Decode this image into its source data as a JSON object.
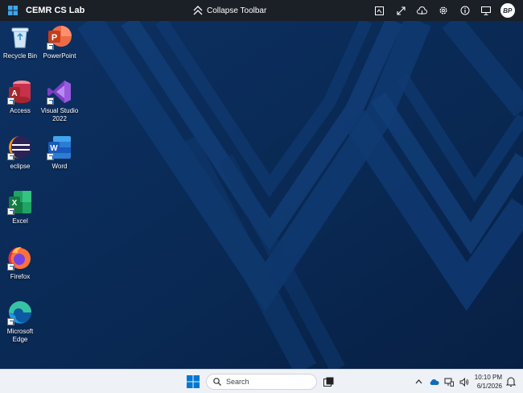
{
  "toolbar": {
    "title": "CEMR CS Lab",
    "collapse_label": "Collapse Toolbar",
    "avatar_initials": "BP",
    "icons": [
      "fit-screen-icon",
      "fullscreen-icon",
      "cloud-sync-icon",
      "settings-icon",
      "info-icon",
      "display-icon",
      "user-avatar"
    ]
  },
  "desktop": {
    "icons": [
      {
        "label": "Recycle Bin",
        "icon": "recycle-bin-icon"
      },
      {
        "label": "PowerPoint",
        "icon": "powerpoint-icon"
      },
      {
        "label": "Access",
        "icon": "access-icon"
      },
      {
        "label": "Visual Studio 2022",
        "icon": "visual-studio-icon"
      },
      {
        "label": "eclipse",
        "icon": "eclipse-icon"
      },
      {
        "label": "Word",
        "icon": "word-icon"
      },
      {
        "label": "Excel",
        "icon": "excel-icon"
      },
      {
        "label": "Firefox",
        "icon": "firefox-icon"
      },
      {
        "label": "Microsoft Edge",
        "icon": "edge-icon"
      }
    ]
  },
  "taskbar": {
    "search_placeholder": "Search",
    "time": "10:10 PM",
    "date": "6/1/2026",
    "tray_icons": [
      "chevron-up-icon",
      "onedrive-icon",
      "network-icon",
      "volume-icon"
    ]
  },
  "colors": {
    "toolbar_bg": "#1b1f26",
    "desktop_bg": "#0a2a55",
    "taskbar_bg": "#eef1f6",
    "windows_blue": "#0078d4"
  }
}
